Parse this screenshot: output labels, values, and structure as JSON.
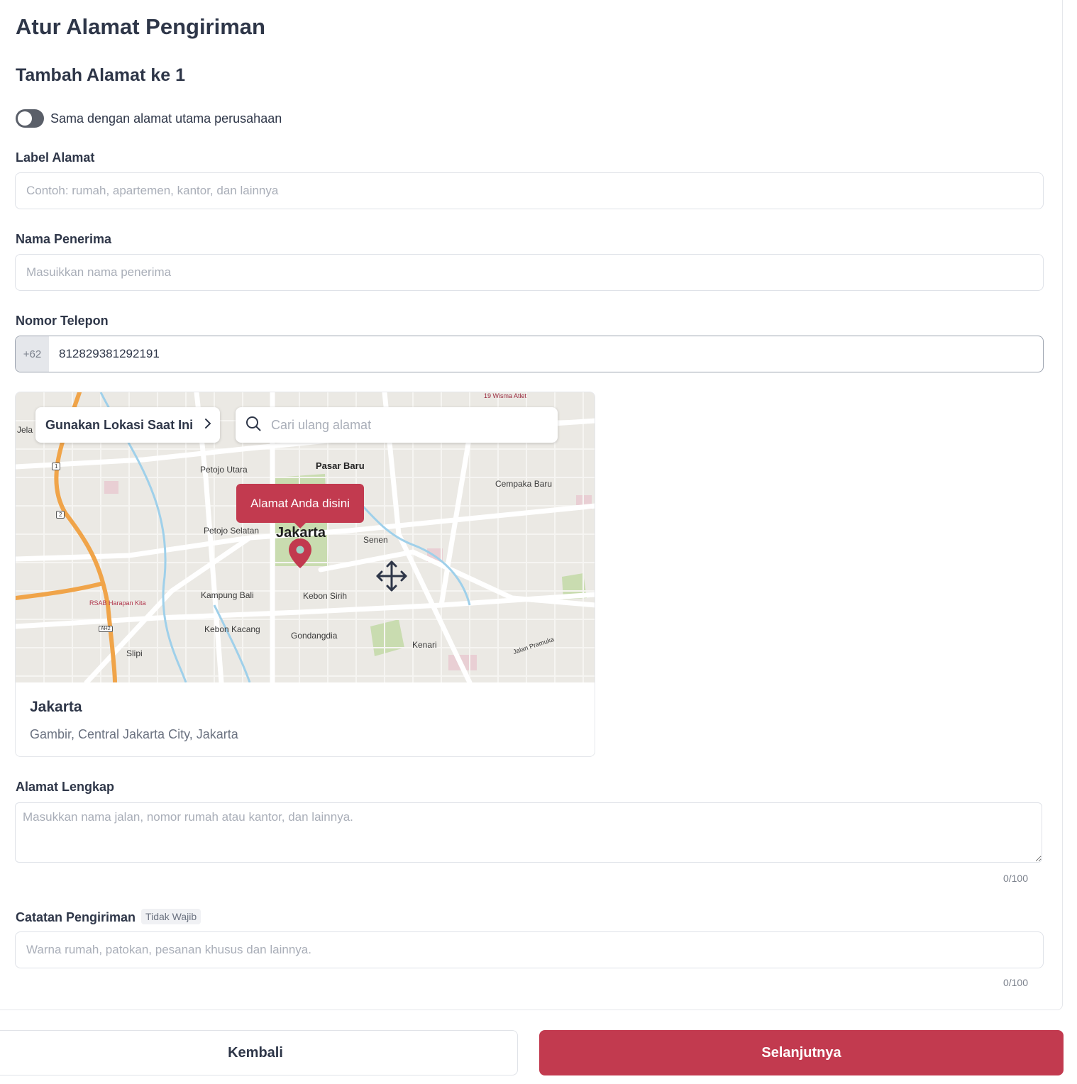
{
  "page": {
    "title": "Atur Alamat Pengiriman",
    "subtitle": "Tambah Alamat ke 1"
  },
  "same_address": {
    "label": "Sama dengan alamat utama perusahaan",
    "checked": false
  },
  "fields": {
    "address_label": {
      "label": "Label Alamat",
      "placeholder": "Contoh: rumah, apartemen, kantor, dan lainnya",
      "value": ""
    },
    "recipient": {
      "label": "Nama Penerima",
      "placeholder": "Masuikkan nama penerima",
      "value": ""
    },
    "phone": {
      "label": "Nomor Telepon",
      "prefix": "+62",
      "value": "812829381292191"
    },
    "full_address": {
      "label": "Alamat Lengkap",
      "placeholder": "Masukkan nama jalan, nomor rumah atau kantor, dan lainnya.",
      "value": "",
      "counter": "0/100"
    },
    "notes": {
      "label": "Catatan Pengiriman",
      "badge": "Tidak Wajib",
      "placeholder": "Warna rumah, patokan, pesanan khusus dan lainnya.",
      "value": "",
      "counter": "0/100"
    }
  },
  "map": {
    "use_location_label": "Gunakan Lokasi Saat Ini",
    "search_placeholder": "Cari ulang alamat",
    "tooltip": "Alamat Anda disini",
    "labels": {
      "wisma": "19 Wisma Atlet",
      "jela": "Jela",
      "petojo_utara": "Petojo Utara",
      "pasar_baru": "Pasar Baru",
      "cempaka_baru": "Cempaka Baru",
      "petojo_selatan": "Petojo Selatan",
      "jakarta": "Jakarta",
      "senen": "Senen",
      "kampung_bali": "Kampung Bali",
      "kebon_sirih": "Kebon Sirih",
      "rsab": "RSAB Harapan Kita",
      "kebon_kacang": "Kebon Kacang",
      "gondangdia": "Gondangdia",
      "kenari": "Kenari",
      "slipi": "Slipi",
      "jalan_pramuka": "Jalan Pramuka",
      "road_1": "1",
      "road_2": "2",
      "ah2": "AH2"
    }
  },
  "location": {
    "name": "Jakarta",
    "detail": "Gambir, Central Jakarta City, Jakarta"
  },
  "actions": {
    "back": "Kembali",
    "next": "Selanjutnya"
  },
  "colors": {
    "primary": "#c23a4f",
    "text": "#2e3648",
    "muted": "#a9aeb8"
  }
}
